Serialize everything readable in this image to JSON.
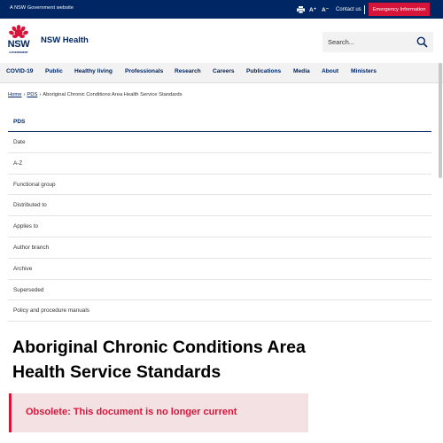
{
  "gov_bar": {
    "text": "A NSW Government website",
    "font_increase": "A⁺",
    "font_decrease": "A⁻",
    "contact_label": "Contact us",
    "emergency_label": "Emergency Information",
    "print_icon": "print-icon"
  },
  "header": {
    "site_name": "NSW Health",
    "logo_text_1": "NSW",
    "logo_text_2": "GOVERNMENT",
    "search_placeholder": "Search...",
    "search_icon": "search-icon"
  },
  "nav": {
    "items": [
      "COVID-19",
      "Public",
      "Healthy living",
      "Professionals",
      "Research",
      "Careers",
      "Publications",
      "Media",
      "About",
      "Ministers"
    ]
  },
  "breadcrumb": {
    "home": "Home",
    "pds": "PDS",
    "current": "Aboriginal Chronic Conditions Area Health Service Standards"
  },
  "side_list": {
    "heading": "PDS",
    "items": [
      "Date",
      "A-Z",
      "Functional group",
      "Distributed to",
      "Applies to",
      "Author branch",
      "Archive",
      "Superseded",
      "Policy and procedure manuals"
    ]
  },
  "page": {
    "title": "Aboriginal Chronic Conditions Area Health Service Standards",
    "alert": "Obsolete: This document is no longer current"
  },
  "colors": {
    "brand_navy": "#002664",
    "alert_red": "#d7153a",
    "alert_bg": "#f4e1e4"
  }
}
